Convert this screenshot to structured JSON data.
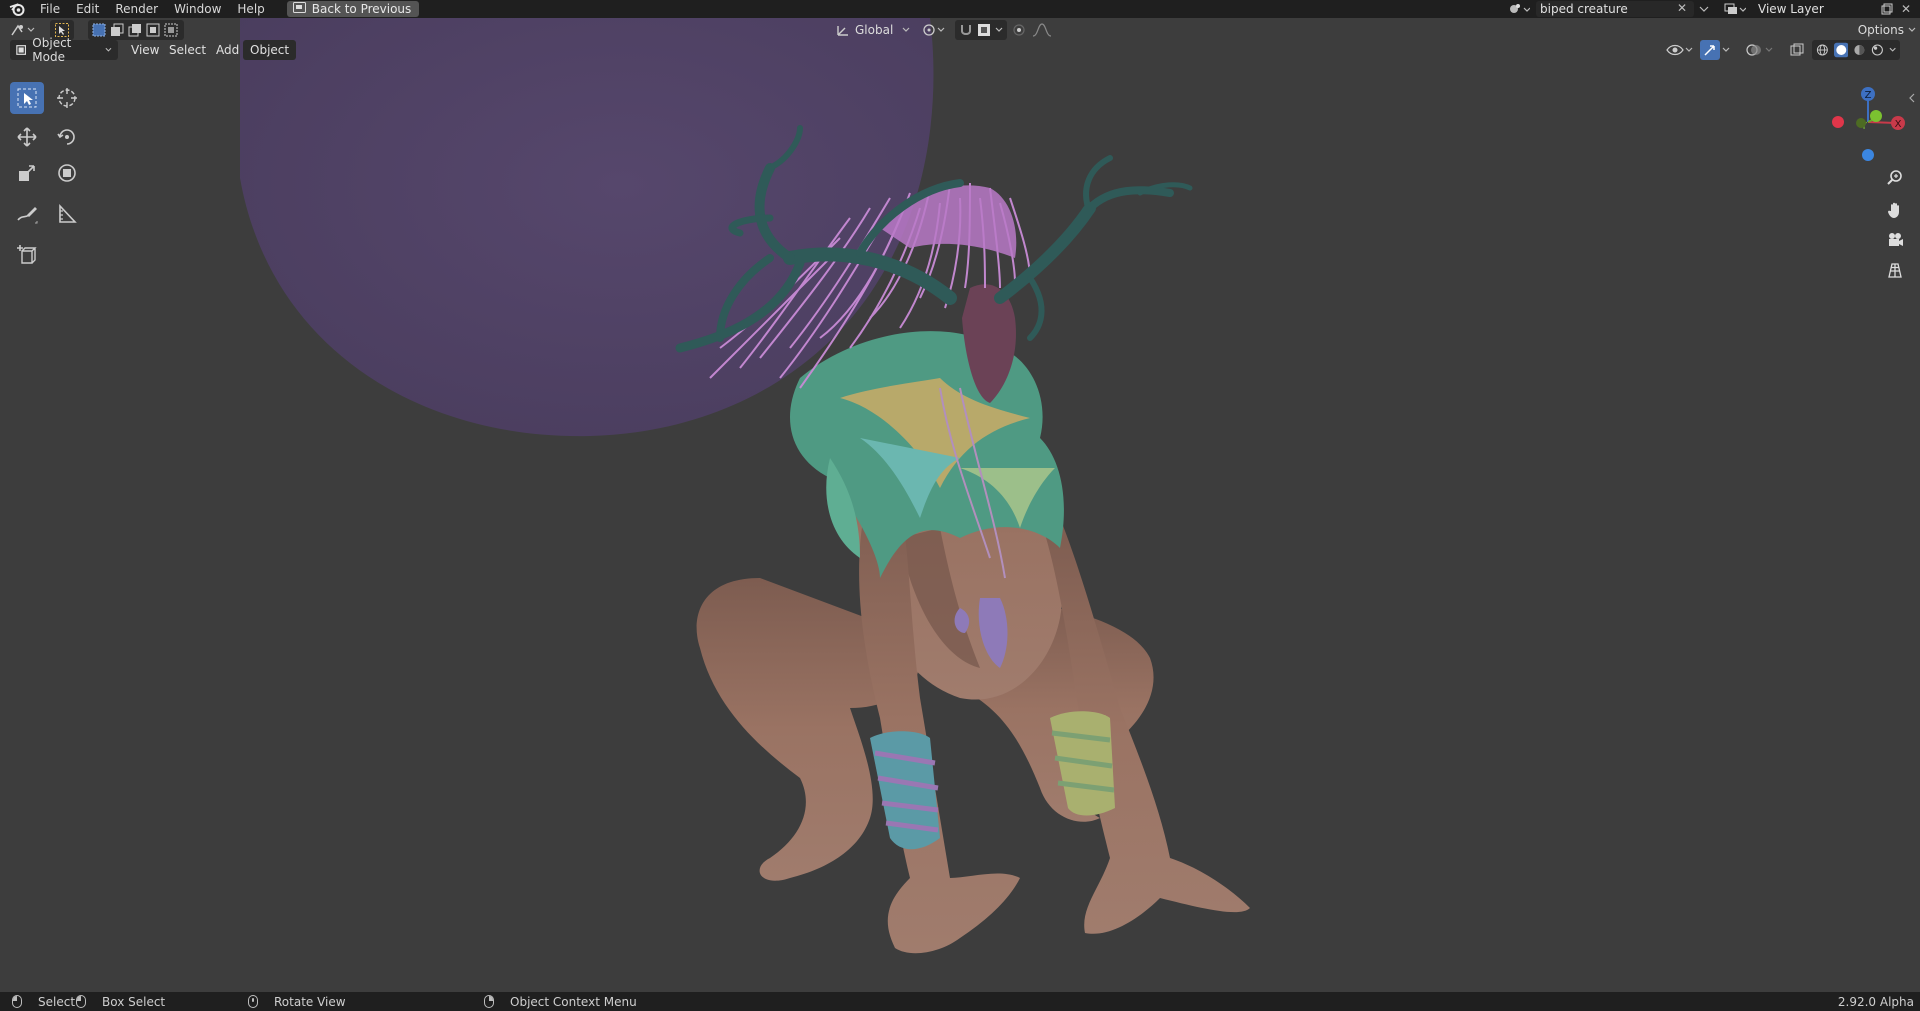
{
  "topbar": {
    "menu": [
      "File",
      "Edit",
      "Render",
      "Window",
      "Help"
    ],
    "back_button": "Back to Previous",
    "scene_name": "biped creature",
    "view_layer": "View Layer"
  },
  "viewport_header": {
    "mode": "Object Mode",
    "menus": [
      "View",
      "Select",
      "Add",
      "Object"
    ],
    "transform_orientation": "Global",
    "options": "Options"
  },
  "statusbar": {
    "select": "Select",
    "box_select": "Box Select",
    "rotate_view": "Rotate View",
    "context_menu": "Object Context Menu",
    "version": "2.92.0 Alpha"
  },
  "gizmo": {
    "x": "X",
    "y": "Y",
    "z": "Z"
  },
  "colors": {
    "background": "#3d3d3d",
    "header": "#1f1f1f",
    "accent": "#4772b3",
    "moon": "#4f4263",
    "skin": "#8f6b5d",
    "antler": "#2f5a58",
    "hair": "#b879c7"
  }
}
